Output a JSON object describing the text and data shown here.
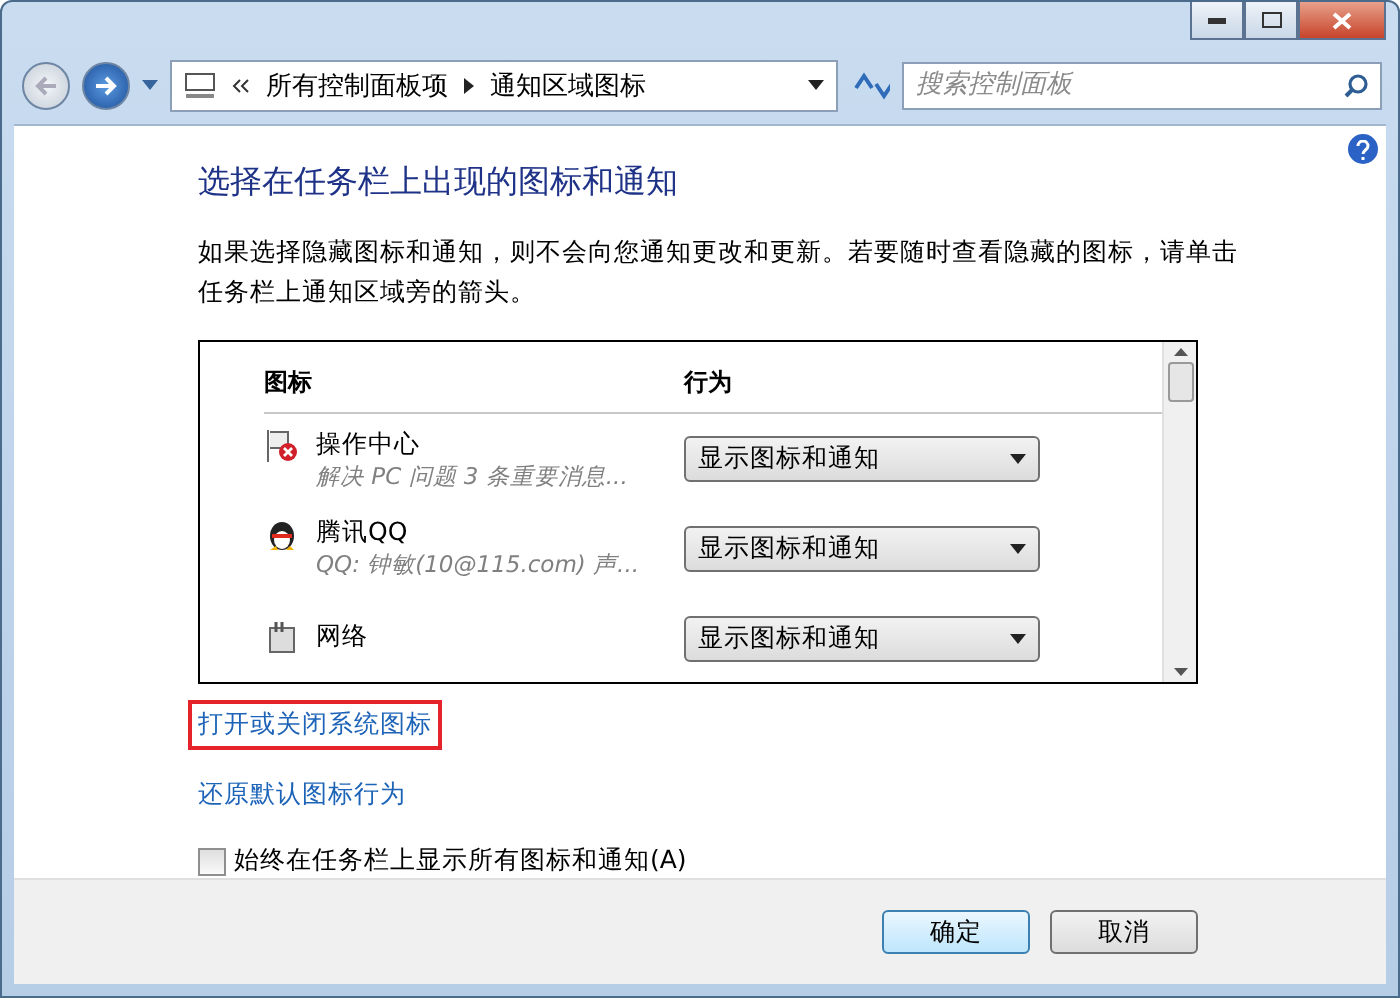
{
  "address_bar": {
    "crumbs": [
      "所有控制面板项",
      "通知区域图标"
    ]
  },
  "search": {
    "placeholder": "搜索控制面板"
  },
  "heading": "选择在任务栏上出现的图标和通知",
  "description": "如果选择隐藏图标和通知，则不会向您通知更改和更新。若要随时查看隐藏的图标，请单击任务栏上通知区域旁的箭头。",
  "table": {
    "columns": [
      "图标",
      "行为"
    ],
    "rows": [
      {
        "kind": "flag",
        "name": "操作中心",
        "detail": "解决 PC 问题  3 条重要消息...",
        "behavior": "显示图标和通知"
      },
      {
        "kind": "penguin",
        "name": "腾讯QQ",
        "detail": "QQ: 钟敏(10@115.com)  声...",
        "behavior": "显示图标和通知"
      },
      {
        "kind": "network",
        "name": "网络",
        "behavior": "显示图标和通知"
      }
    ]
  },
  "links": [
    {
      "label": "打开或关闭系统图标",
      "highlighted": true
    },
    {
      "label": "还原默认图标行为",
      "highlighted": false
    }
  ],
  "always_show": {
    "label": "始终在任务栏上显示所有图标和通知(A)",
    "checked": false
  },
  "buttons": [
    {
      "label": "确定",
      "default": true
    },
    {
      "label": "取消",
      "default": false
    }
  ]
}
